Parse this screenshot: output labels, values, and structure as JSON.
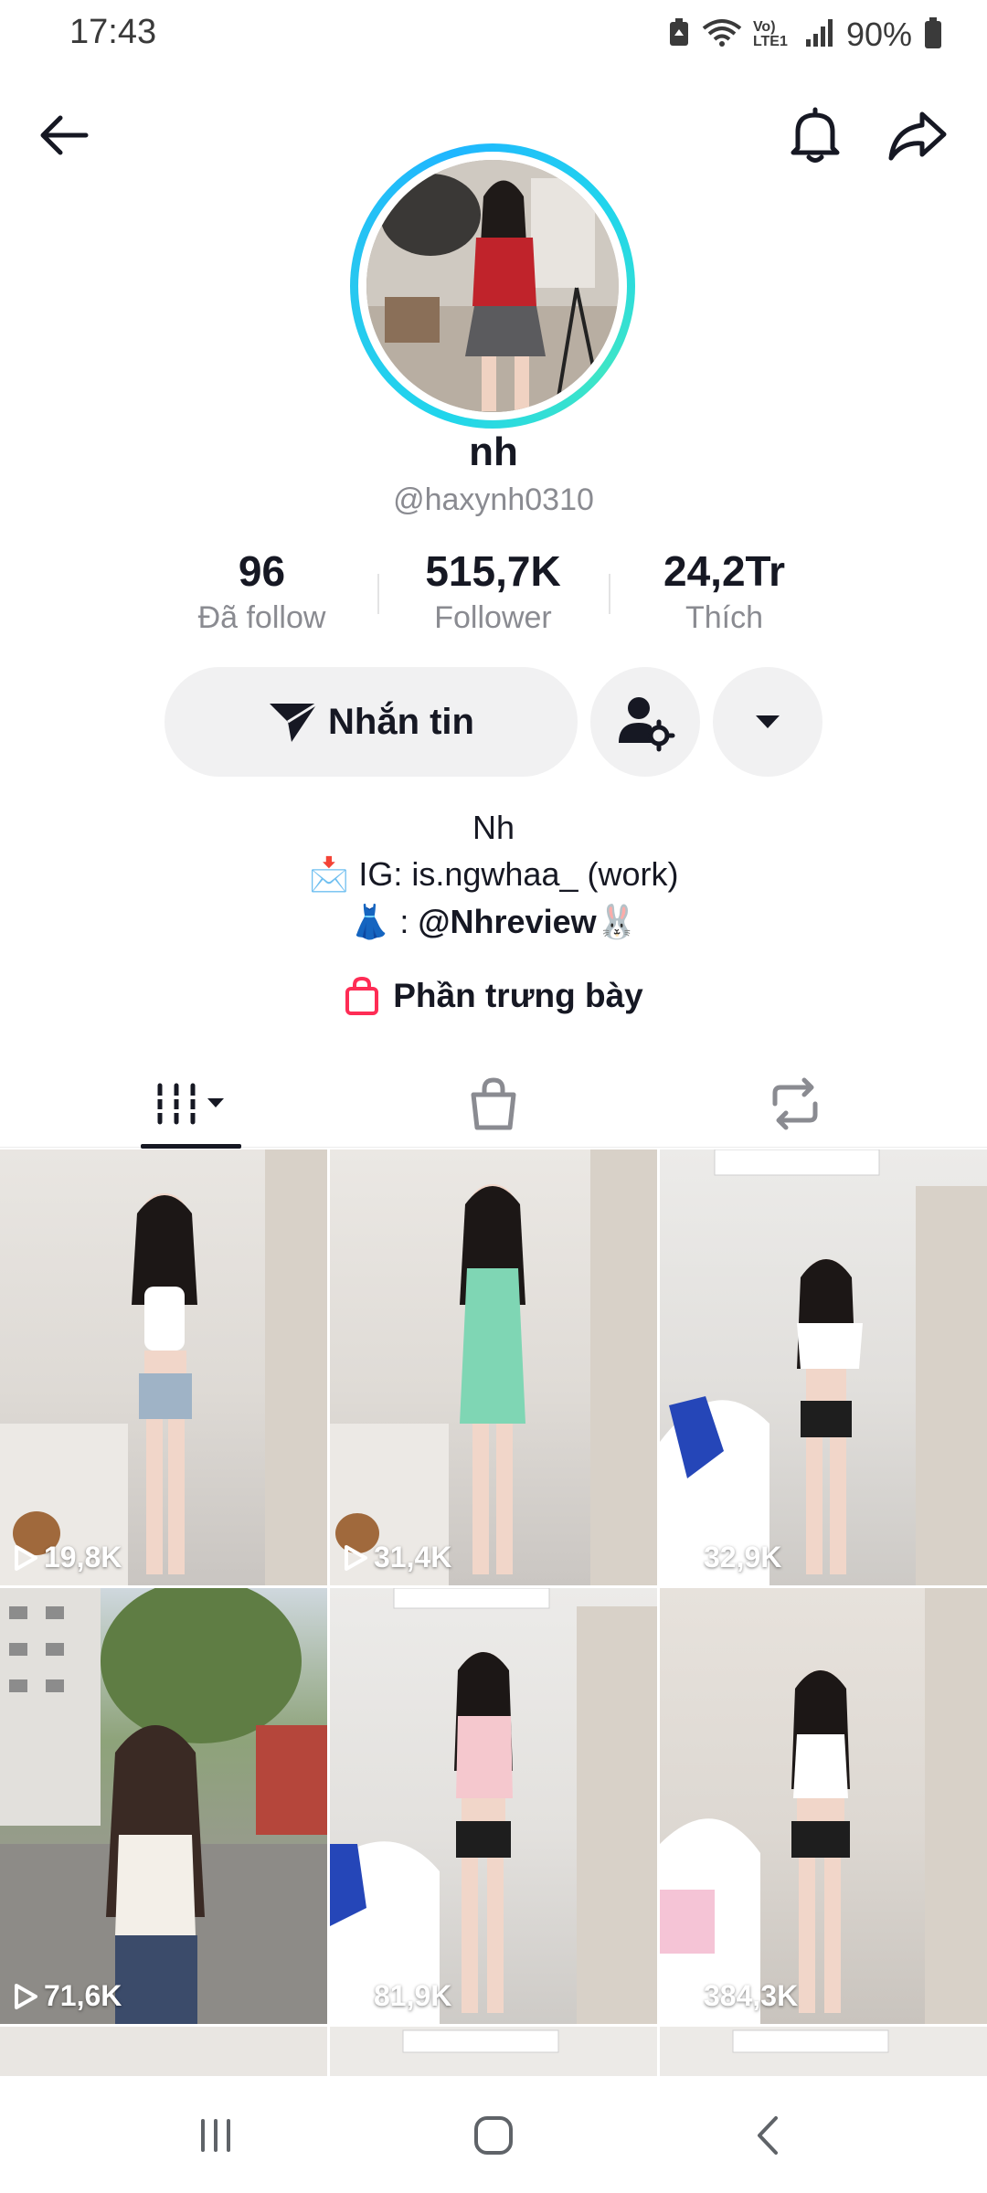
{
  "status_bar": {
    "time": "17:43",
    "network": "Vo) LTE1",
    "battery": "90%"
  },
  "header": {
    "back_icon": "arrow-left-icon",
    "bell_icon": "bell-icon",
    "share_icon": "share-arrow-icon"
  },
  "profile": {
    "display_name": "nh",
    "username": "@haxynh0310"
  },
  "stats": [
    {
      "value": "96",
      "label": "Đã follow"
    },
    {
      "value": "515,7K",
      "label": "Follower"
    },
    {
      "value": "24,2Tr",
      "label": "Thích"
    }
  ],
  "actions": {
    "message_label": "Nhắn tin"
  },
  "bio": {
    "line1": "Nh",
    "line2_emoji": "📩",
    "line2_text": " IG: is.ngwhaa_  (work)",
    "line3_emoji": "👗",
    "line3_prefix": " : ",
    "line3_handle": "@Nhreview",
    "line3_suffix_emoji": "🐰"
  },
  "showcase": {
    "label": "Phần trưng bày"
  },
  "tabs": [
    {
      "icon": "videos-grid-icon",
      "active": true
    },
    {
      "icon": "shopping-bag-icon",
      "active": false
    },
    {
      "icon": "repost-icon",
      "active": false
    }
  ],
  "videos": [
    {
      "views": "19,8K"
    },
    {
      "views": "31,4K"
    },
    {
      "views": "32,9K"
    },
    {
      "views": "71,6K"
    },
    {
      "views": "81,9K"
    },
    {
      "views": "384,3K"
    }
  ],
  "colors": {
    "accent_ring": "#20d5ec",
    "text_primary": "#161823",
    "text_secondary": "#8a8b91",
    "button_bg": "#f1f1f2",
    "showcase_icon": "#fe2c55"
  }
}
